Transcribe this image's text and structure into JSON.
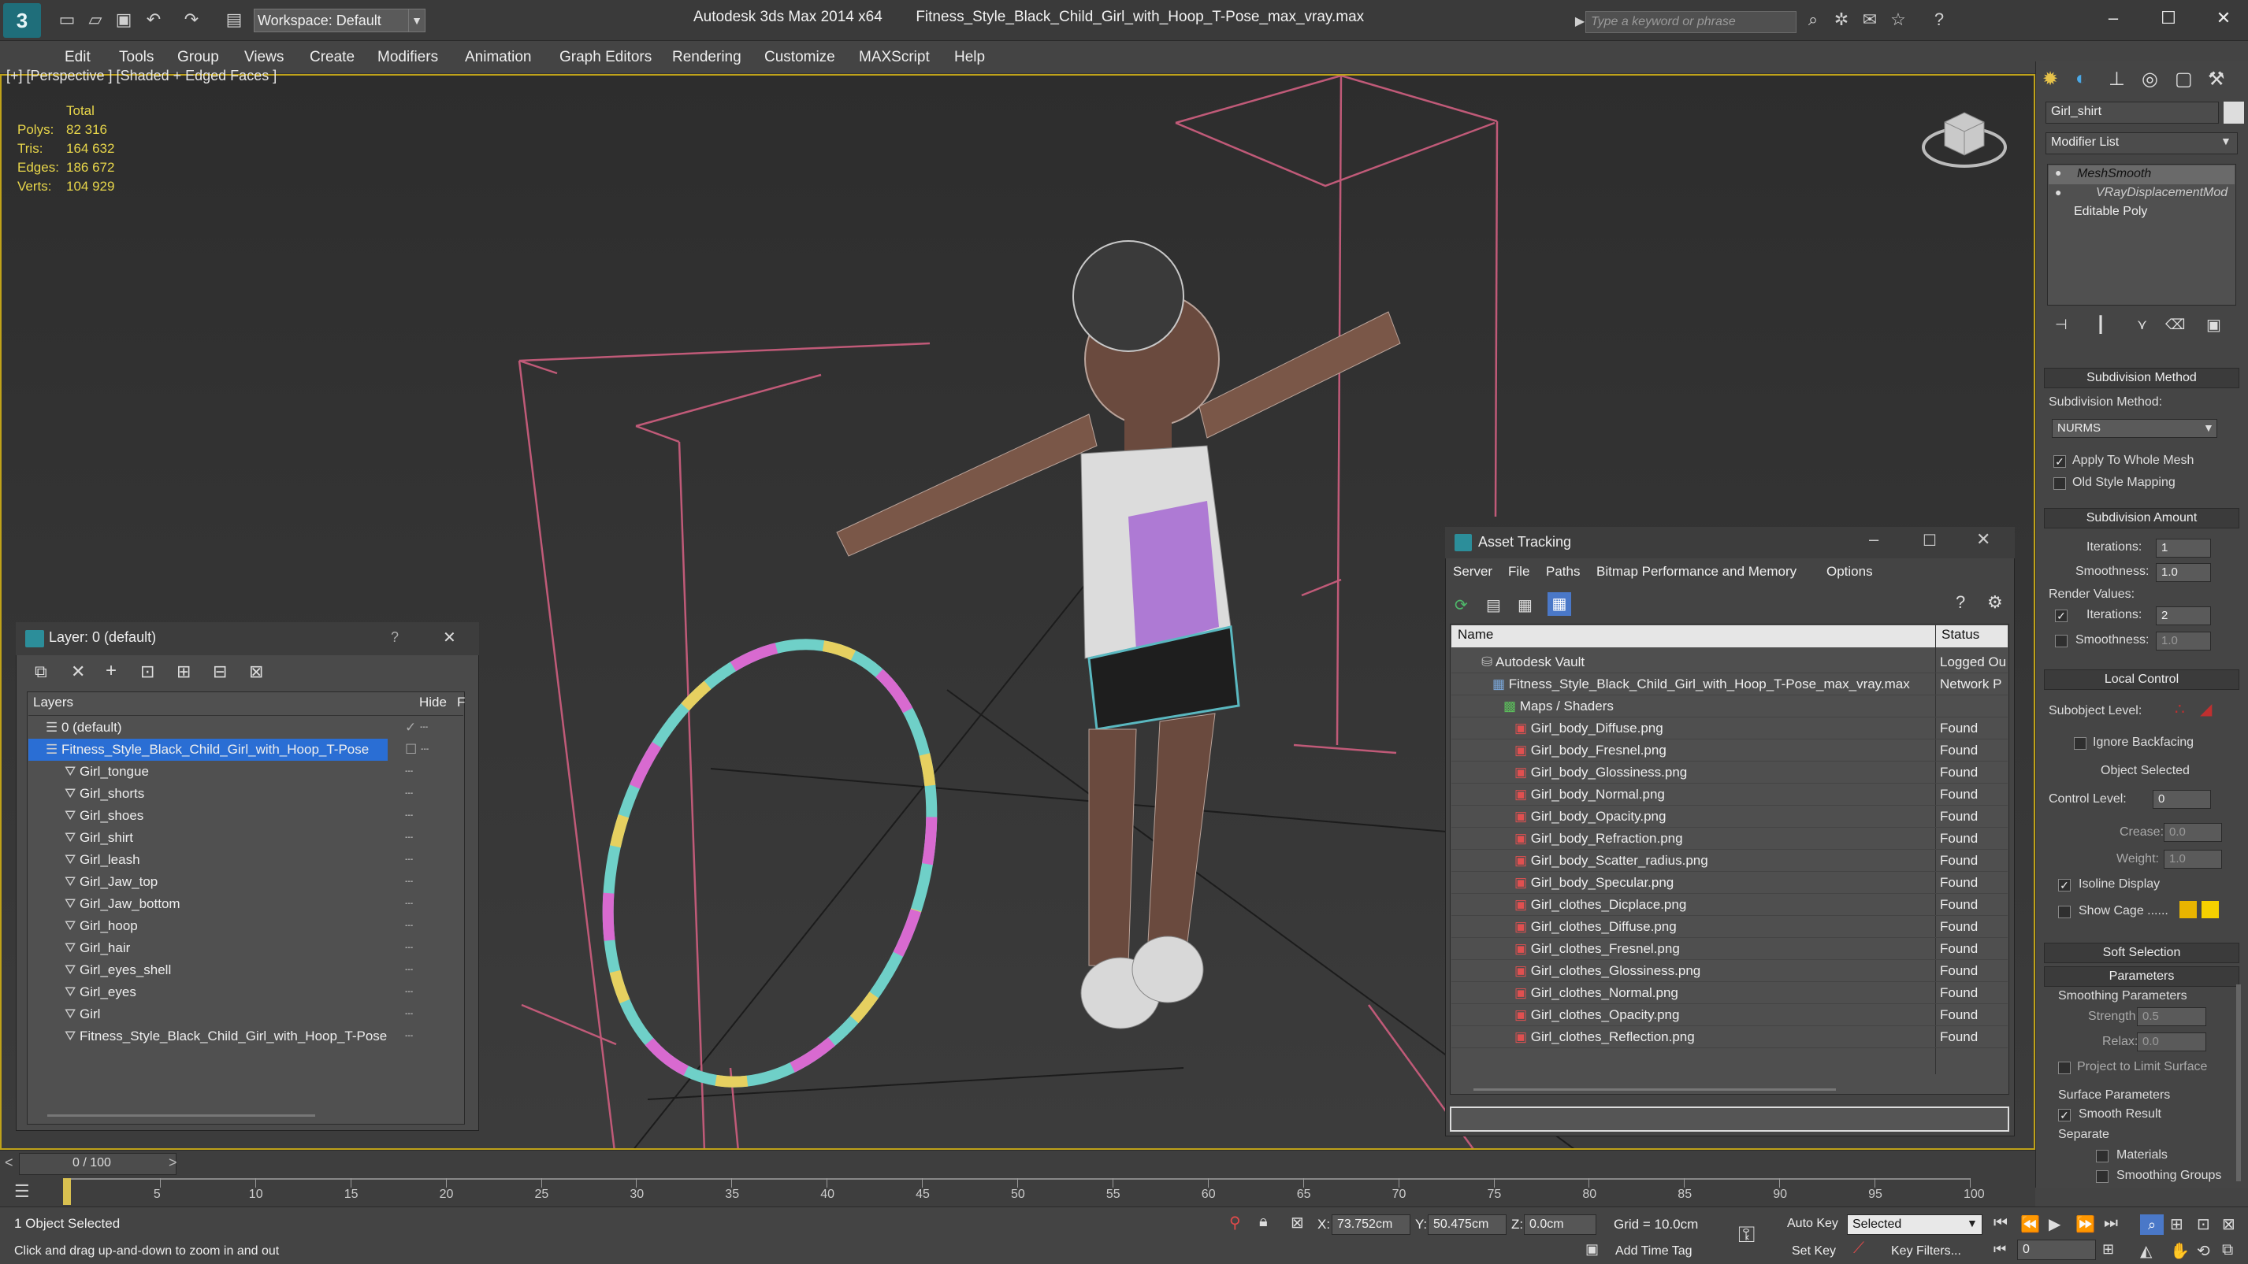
{
  "titlebar": {
    "app_name": "Autodesk 3ds Max  2014 x64",
    "file_name": "Fitness_Style_Black_Child_Girl_with_Hoop_T-Pose_max_vray.max",
    "workspace": "Workspace: Default",
    "search_placeholder": "Type a keyword or phrase"
  },
  "menu": [
    "Edit",
    "Tools",
    "Group",
    "Views",
    "Create",
    "Modifiers",
    "Animation",
    "Graph Editors",
    "Rendering",
    "Customize",
    "MAXScript",
    "Help"
  ],
  "viewport": {
    "label": "[+] [Perspective ] [Shaded + Edged Faces ]",
    "stats": {
      "header": "Total",
      "rows": [
        {
          "label": "Polys:",
          "value": "82 316"
        },
        {
          "label": "Tris:",
          "value": "164 632"
        },
        {
          "label": "Edges:",
          "value": "186 672"
        },
        {
          "label": "Verts:",
          "value": "104 929"
        }
      ]
    }
  },
  "layer_panel": {
    "title": "Layer: 0 (default)",
    "help": "?",
    "col_layers": "Layers",
    "col_hide": "Hide",
    "col_f": "F",
    "rows": [
      {
        "name": "0 (default)",
        "level": 0,
        "selected": false
      },
      {
        "name": "Fitness_Style_Black_Child_Girl_with_Hoop_T-Pose",
        "level": 0,
        "selected": true
      },
      {
        "name": "Girl_tongue",
        "level": 1,
        "selected": false
      },
      {
        "name": "Girl_shorts",
        "level": 1,
        "selected": false
      },
      {
        "name": "Girl_shoes",
        "level": 1,
        "selected": false
      },
      {
        "name": "Girl_shirt",
        "level": 1,
        "selected": false
      },
      {
        "name": "Girl_leash",
        "level": 1,
        "selected": false
      },
      {
        "name": "Girl_Jaw_top",
        "level": 1,
        "selected": false
      },
      {
        "name": "Girl_Jaw_bottom",
        "level": 1,
        "selected": false
      },
      {
        "name": "Girl_hoop",
        "level": 1,
        "selected": false
      },
      {
        "name": "Girl_hair",
        "level": 1,
        "selected": false
      },
      {
        "name": "Girl_eyes_shell",
        "level": 1,
        "selected": false
      },
      {
        "name": "Girl_eyes",
        "level": 1,
        "selected": false
      },
      {
        "name": "Girl",
        "level": 1,
        "selected": false
      },
      {
        "name": "Fitness_Style_Black_Child_Girl_with_Hoop_T-Pose",
        "level": 1,
        "selected": false
      }
    ]
  },
  "asset_panel": {
    "title": "Asset Tracking",
    "menu": [
      "Server",
      "File",
      "Paths",
      "Bitmap Performance and Memory",
      "Options"
    ],
    "col_name": "Name",
    "col_status": "Status",
    "rows": [
      {
        "name": "Autodesk Vault",
        "status": "Logged Ou",
        "level": 0
      },
      {
        "name": "Fitness_Style_Black_Child_Girl_with_Hoop_T-Pose_max_vray.max",
        "status": "Network P",
        "level": 1
      },
      {
        "name": "Maps / Shaders",
        "status": "",
        "level": 2
      },
      {
        "name": "Girl_body_Diffuse.png",
        "status": "Found",
        "level": 3
      },
      {
        "name": "Girl_body_Fresnel.png",
        "status": "Found",
        "level": 3
      },
      {
        "name": "Girl_body_Glossiness.png",
        "status": "Found",
        "level": 3
      },
      {
        "name": "Girl_body_Normal.png",
        "status": "Found",
        "level": 3
      },
      {
        "name": "Girl_body_Opacity.png",
        "status": "Found",
        "level": 3
      },
      {
        "name": "Girl_body_Refraction.png",
        "status": "Found",
        "level": 3
      },
      {
        "name": "Girl_body_Scatter_radius.png",
        "status": "Found",
        "level": 3
      },
      {
        "name": "Girl_body_Specular.png",
        "status": "Found",
        "level": 3
      },
      {
        "name": "Girl_clothes_Dicplace.png",
        "status": "Found",
        "level": 3
      },
      {
        "name": "Girl_clothes_Diffuse.png",
        "status": "Found",
        "level": 3
      },
      {
        "name": "Girl_clothes_Fresnel.png",
        "status": "Found",
        "level": 3
      },
      {
        "name": "Girl_clothes_Glossiness.png",
        "status": "Found",
        "level": 3
      },
      {
        "name": "Girl_clothes_Normal.png",
        "status": "Found",
        "level": 3
      },
      {
        "name": "Girl_clothes_Opacity.png",
        "status": "Found",
        "level": 3
      },
      {
        "name": "Girl_clothes_Reflection.png",
        "status": "Found",
        "level": 3
      }
    ]
  },
  "command_panel": {
    "object_name": "Girl_shirt",
    "modifier_list": "Modifier List",
    "stack": [
      "MeshSmooth",
      "VRayDisplacementMod",
      "Editable Poly"
    ],
    "subdivision_method": {
      "header": "Subdivision Method",
      "label": "Subdivision Method:",
      "value": "NURMS",
      "apply_whole_mesh": "Apply To Whole Mesh",
      "old_style": "Old Style Mapping"
    },
    "subdivision_amount": {
      "header": "Subdivision Amount",
      "iterations_label": "Iterations:",
      "iterations": "1",
      "smoothness_label": "Smoothness:",
      "smoothness": "1.0",
      "render_values": "Render Values:",
      "render_iterations": "2",
      "render_smoothness": "1.0"
    },
    "local_control": {
      "header": "Local Control",
      "subobject_level": "Subobject Level:",
      "ignore_backfacing": "Ignore Backfacing",
      "object_selected": "Object Selected",
      "control_level": "Control Level:",
      "control_level_value": "0",
      "crease": "Crease:",
      "crease_value": "0.0",
      "weight": "Weight:",
      "weight_value": "1.0",
      "isoline": "Isoline Display",
      "show_cage": "Show Cage ......"
    },
    "soft_selection": "Soft Selection",
    "parameters": {
      "header": "Parameters",
      "smoothing": "Smoothing Parameters",
      "strength": "Strength:",
      "strength_value": "0.5",
      "relax": "Relax:",
      "relax_value": "0.0",
      "project": "Project to Limit Surface",
      "surface": "Surface Parameters",
      "smooth_result": "Smooth Result",
      "separate": "Separate",
      "materials": "Materials",
      "smoothing_groups": "Smoothing Groups"
    },
    "colors": {
      "cage1": "#e8b400",
      "cage2": "#f5d000"
    }
  },
  "timeline": {
    "frame": "0 / 100",
    "ticks": [
      "5",
      "10",
      "15",
      "20",
      "25",
      "30",
      "35",
      "40",
      "45",
      "50",
      "55",
      "60",
      "65",
      "70",
      "75",
      "80",
      "85",
      "90",
      "95",
      "100"
    ]
  },
  "status": {
    "selection": "1 Object Selected",
    "hint": "Click and drag up-and-down to zoom in and out",
    "x_label": "X:",
    "x": "73.752cm",
    "y_label": "Y:",
    "y": "50.475cm",
    "z_label": "Z:",
    "z": "0.0cm",
    "grid": "Grid = 10.0cm",
    "add_time_tag": "Add Time Tag",
    "auto_key": "Auto Key",
    "set_key": "Set Key",
    "key_mode": "Selected",
    "key_filters": "Key Filters...",
    "frame_field": "0"
  }
}
